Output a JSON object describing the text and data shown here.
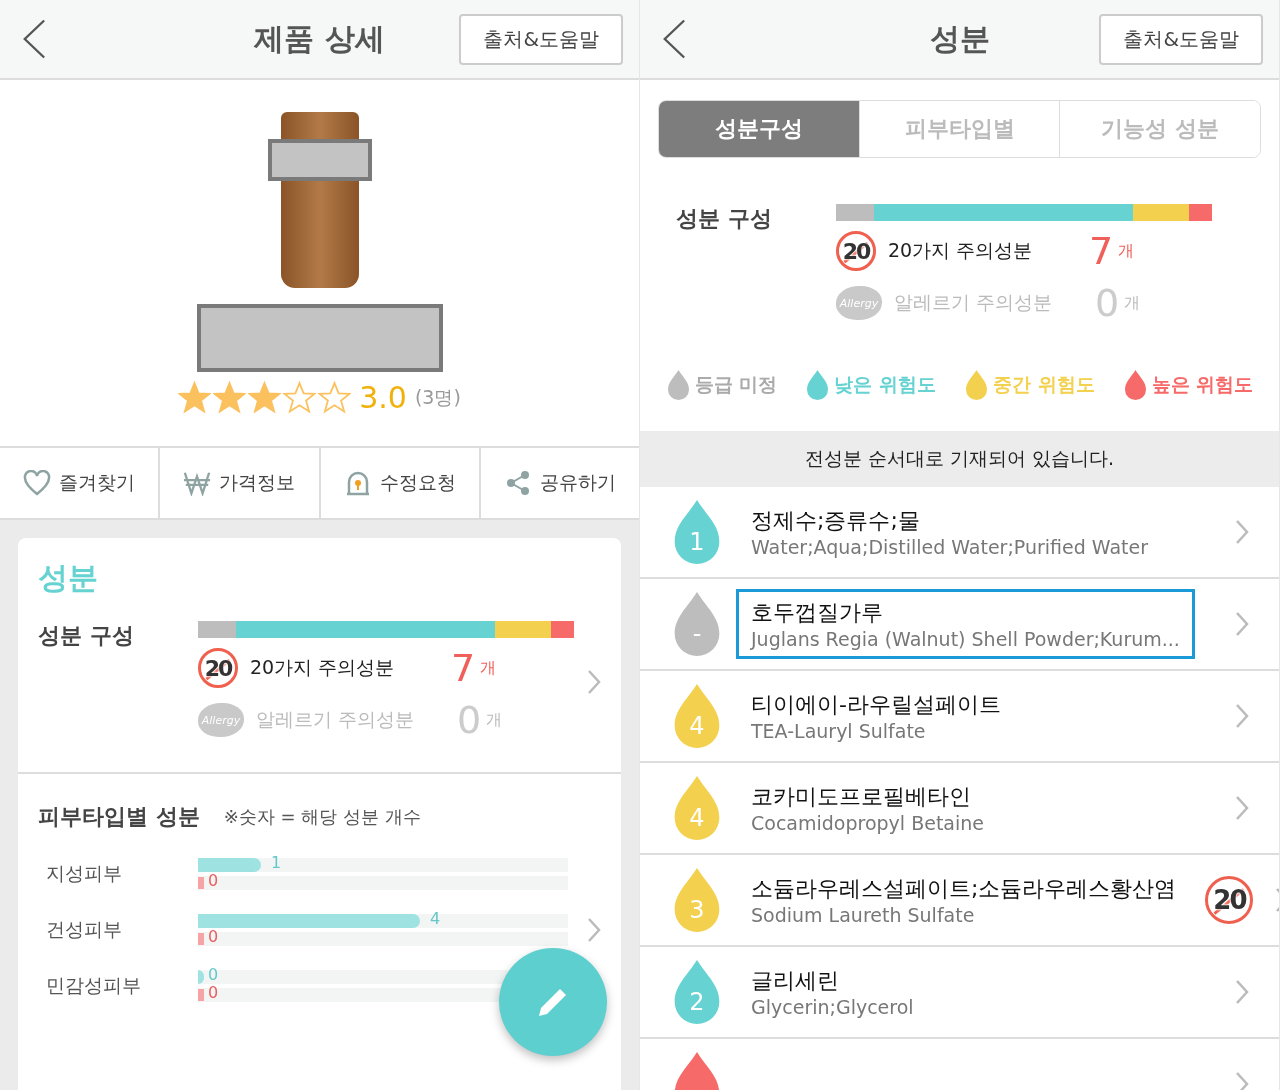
{
  "left": {
    "header": {
      "title": "제품 상세",
      "help_button": "출처&도움말"
    },
    "product": {
      "stars": 3,
      "rating": "3.0",
      "review_count": "(3명)"
    },
    "actions": [
      {
        "kind": "favorite",
        "label": "즐겨찾기"
      },
      {
        "kind": "price",
        "label": "가격정보"
      },
      {
        "kind": "edit",
        "label": "수정요청"
      },
      {
        "kind": "share",
        "label": "공유하기"
      }
    ],
    "card": {
      "title": "성분",
      "composition": {
        "label": "성분 구성",
        "caution": {
          "active": true,
          "icon_text": "20",
          "label": "20가지 주의성분",
          "count": "7",
          "unit": "개"
        },
        "allergy": {
          "active": false,
          "icon_text": "Allergy",
          "label": "알레르기 주의성분",
          "count": "0",
          "unit": "개"
        }
      },
      "skin": {
        "title": "피부타입별 성분",
        "note": "※숫자 = 해당 성분 개수",
        "rows": [
          {
            "label": "지성피부",
            "good": {
              "level": 0.17,
              "count": "1"
            },
            "bad": {
              "level": 0,
              "count": "0"
            }
          },
          {
            "label": "건성피부",
            "good": {
              "level": 0.6,
              "count": "4"
            },
            "bad": {
              "level": 0,
              "count": "0"
            }
          },
          {
            "label": "민감성피부",
            "good": {
              "level": 0,
              "count": "0"
            },
            "bad": {
              "level": 0,
              "count": "0"
            }
          }
        ]
      }
    }
  },
  "right": {
    "header": {
      "title": "성분",
      "help_button": "출처&도움말"
    },
    "tabs": [
      {
        "label": "성분구성",
        "selected": true
      },
      {
        "label": "피부타입별",
        "selected": false
      },
      {
        "label": "기능성 성분",
        "selected": false
      }
    ],
    "composition": {
      "label": "성분 구성",
      "caution": {
        "active": true,
        "icon_text": "20",
        "label": "20가지 주의성분",
        "count": "7",
        "unit": "개"
      },
      "allergy": {
        "active": false,
        "icon_text": "Allergy",
        "label": "알레르기 주의성분",
        "count": "0",
        "unit": "개"
      }
    },
    "legend": [
      {
        "color": "#bdbdbd",
        "label": "등급 미정"
      },
      {
        "color": "#66d2d2",
        "label": "낮은 위험도"
      },
      {
        "color": "#f3d14e",
        "label": "중간 위험도"
      },
      {
        "color": "#f76a6a",
        "label": "높은 위험도"
      }
    ],
    "notice": "전성분 순서대로 기재되어 있습니다.",
    "ingredients": [
      {
        "color": "#66d2d2",
        "grade": "1",
        "name": "정제수;증류수;물",
        "inci": "Water;Aqua;Distilled Water;Purified Water",
        "focused": false
      },
      {
        "color": "#bdbdbd",
        "grade": "-",
        "name": "호두껍질가루",
        "inci": "Juglans Regia (Walnut) Shell Powder;Kurum...",
        "focused": true
      },
      {
        "color": "#f3d14e",
        "grade": "4",
        "name": "티이에이-라우릴설페이트",
        "inci": "TEA-Lauryl Sulfate",
        "focused": false
      },
      {
        "color": "#f3d14e",
        "grade": "4",
        "name": "코카미도프로필베타인",
        "inci": "Cocamidopropyl Betaine",
        "focused": false
      },
      {
        "color": "#f3d14e",
        "grade": "3",
        "name": "소듐라우레스설페이트;소듐라우레스황산염",
        "inci": "Sodium Laureth Sulfate",
        "focused": false,
        "caution_mark": "20"
      },
      {
        "color": "#66d2d2",
        "grade": "2",
        "name": "글리세린",
        "inci": "Glycerin;Glycerol",
        "focused": false
      },
      {
        "color": "#f76a6a",
        "focused": false
      }
    ]
  }
}
